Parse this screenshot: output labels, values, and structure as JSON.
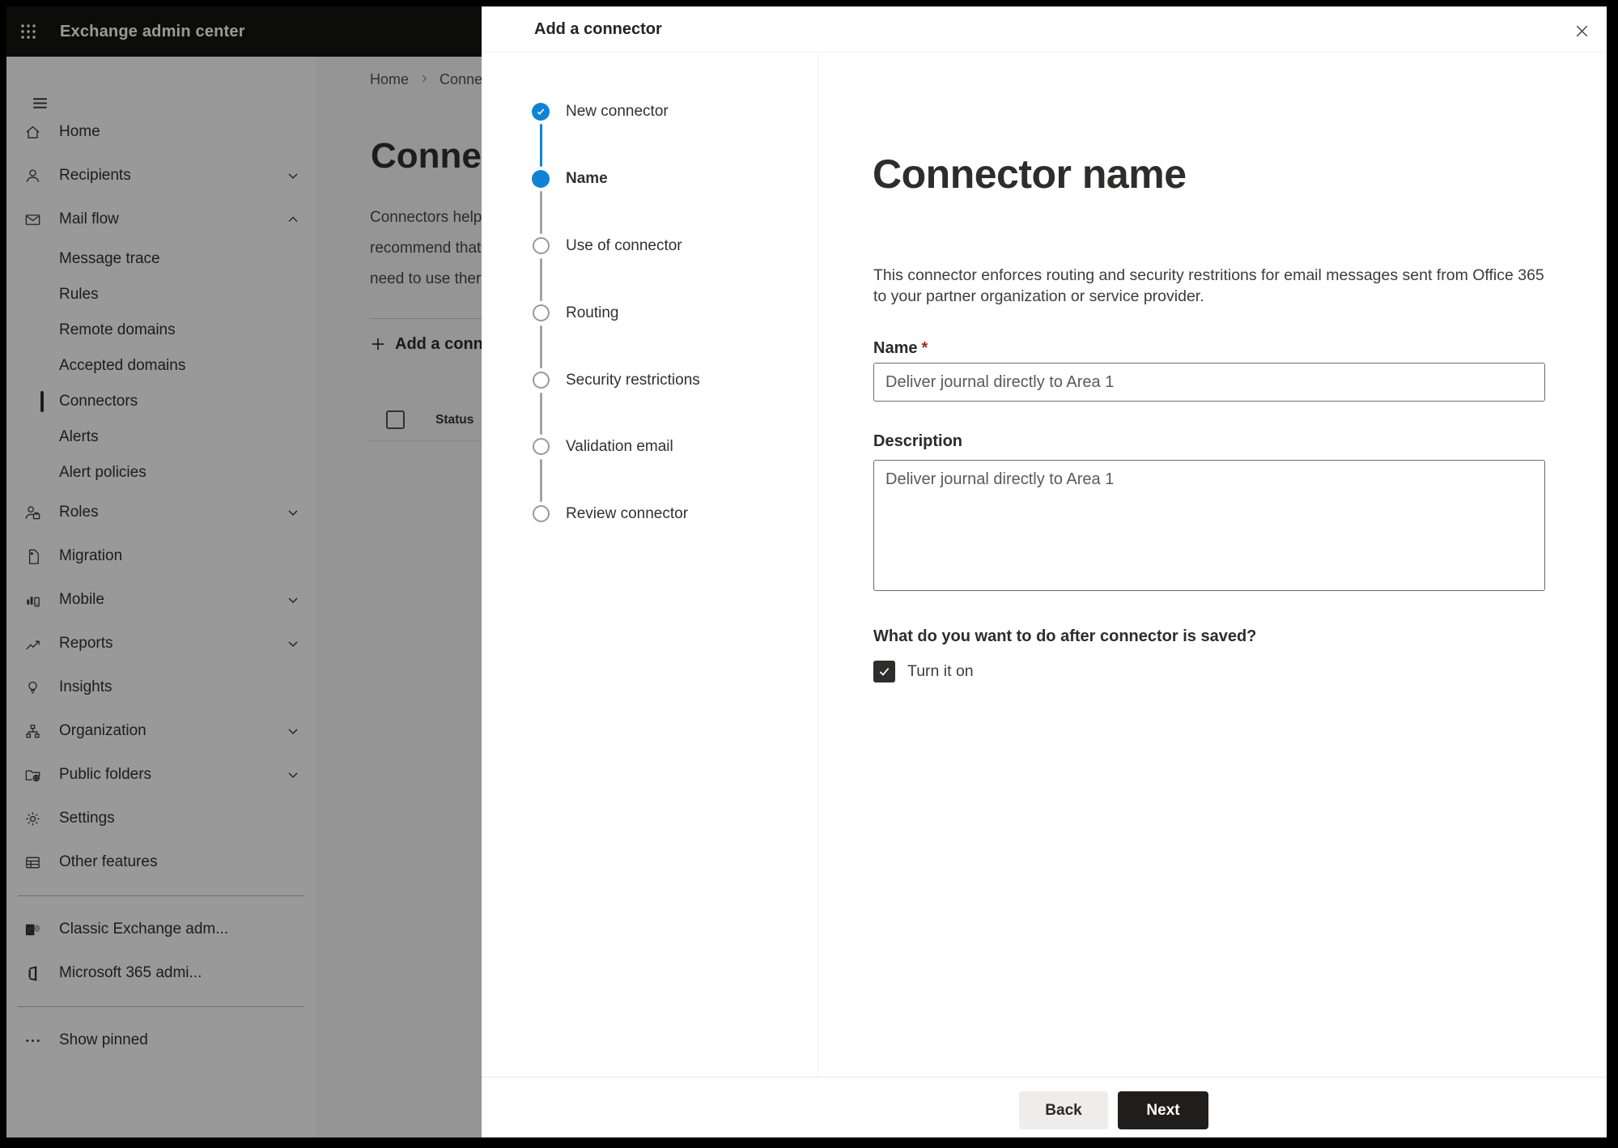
{
  "header": {
    "app_title": "Exchange admin center"
  },
  "sidebar": {
    "items": [
      {
        "label": "Home"
      },
      {
        "label": "Recipients"
      },
      {
        "label": "Mail flow"
      },
      {
        "label": "Message trace"
      },
      {
        "label": "Rules"
      },
      {
        "label": "Remote domains"
      },
      {
        "label": "Accepted domains"
      },
      {
        "label": "Connectors",
        "selected": true
      },
      {
        "label": "Alerts"
      },
      {
        "label": "Alert policies"
      },
      {
        "label": "Roles"
      },
      {
        "label": "Migration"
      },
      {
        "label": "Mobile"
      },
      {
        "label": "Reports"
      },
      {
        "label": "Insights"
      },
      {
        "label": "Organization"
      },
      {
        "label": "Public folders"
      },
      {
        "label": "Settings"
      },
      {
        "label": "Other features"
      },
      {
        "label": "Classic Exchange adm..."
      },
      {
        "label": "Microsoft 365 admi..."
      },
      {
        "label": "Show pinned"
      }
    ]
  },
  "page": {
    "breadcrumb": {
      "home": "Home",
      "current": "Conne"
    },
    "heading": "Connec",
    "intro_lines": "Connectors help\nrecommend that\nneed to use ther",
    "add_button": "Add a conn",
    "table": {
      "status_header": "Status"
    }
  },
  "dialog": {
    "title": "Add a connector",
    "steps": [
      {
        "label": "New connector",
        "state": "completed"
      },
      {
        "label": "Name",
        "state": "current"
      },
      {
        "label": "Use of connector",
        "state": "upcoming"
      },
      {
        "label": "Routing",
        "state": "upcoming"
      },
      {
        "label": "Security restrictions",
        "state": "upcoming"
      },
      {
        "label": "Validation email",
        "state": "upcoming"
      },
      {
        "label": "Review connector",
        "state": "upcoming"
      }
    ],
    "content": {
      "heading": "Connector name",
      "description": "This connector enforces routing and security restritions for email messages sent from Office 365 to your partner organization or service provider.",
      "name_label": "Name",
      "required_mark": "*",
      "name_value": "Deliver journal directly to Area 1",
      "description_label": "Description",
      "description_value": "Deliver journal directly to Area 1",
      "after_save_question": "What do you want to do after connector is saved?",
      "turn_it_on_label": "Turn it on"
    },
    "footer": {
      "back": "Back",
      "next": "Next"
    }
  },
  "colors": {
    "accent_blue": "#1083d6",
    "required_red": "#a4262c",
    "header_bg": "#151413"
  }
}
